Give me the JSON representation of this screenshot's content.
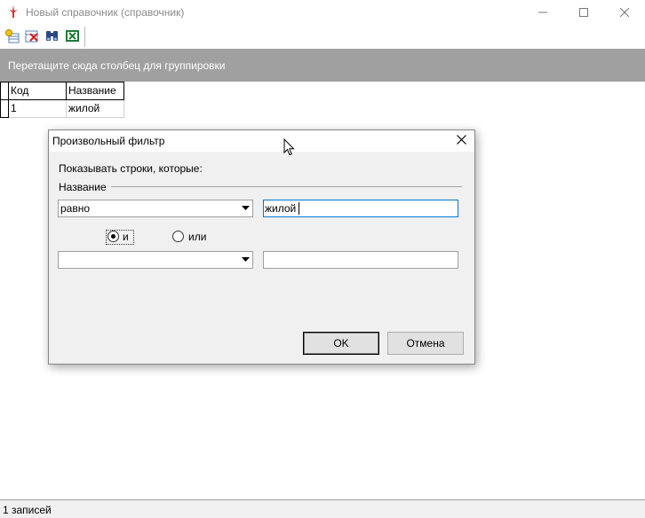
{
  "window": {
    "title": "Новый справочник  (справочник)"
  },
  "toolbar": {
    "buttons": [
      {
        "icon": "add-record-icon"
      },
      {
        "icon": "delete-record-icon"
      },
      {
        "icon": "binoculars-search-icon"
      },
      {
        "icon": "excel-export-icon"
      }
    ]
  },
  "grid": {
    "group_hint": "Перетащите сюда столбец для группировки",
    "columns": [
      "Код",
      "Название"
    ],
    "rows": [
      [
        "1",
        "жилой"
      ]
    ]
  },
  "status": {
    "text": "1 записей"
  },
  "dialog": {
    "title": "Произвольный фильтр",
    "prompt": "Показывать строки, которые:",
    "field_name": "Название",
    "condition1": {
      "operator": "равно",
      "value": "жилой"
    },
    "logic": {
      "and_label": "и",
      "or_label": "или",
      "selected": "и"
    },
    "condition2": {
      "operator": "",
      "value": ""
    },
    "ok_label": "OK",
    "cancel_label": "Отмена"
  },
  "colors": {
    "group_panel": "#a0a0a0",
    "focus_border": "#0078d7"
  }
}
